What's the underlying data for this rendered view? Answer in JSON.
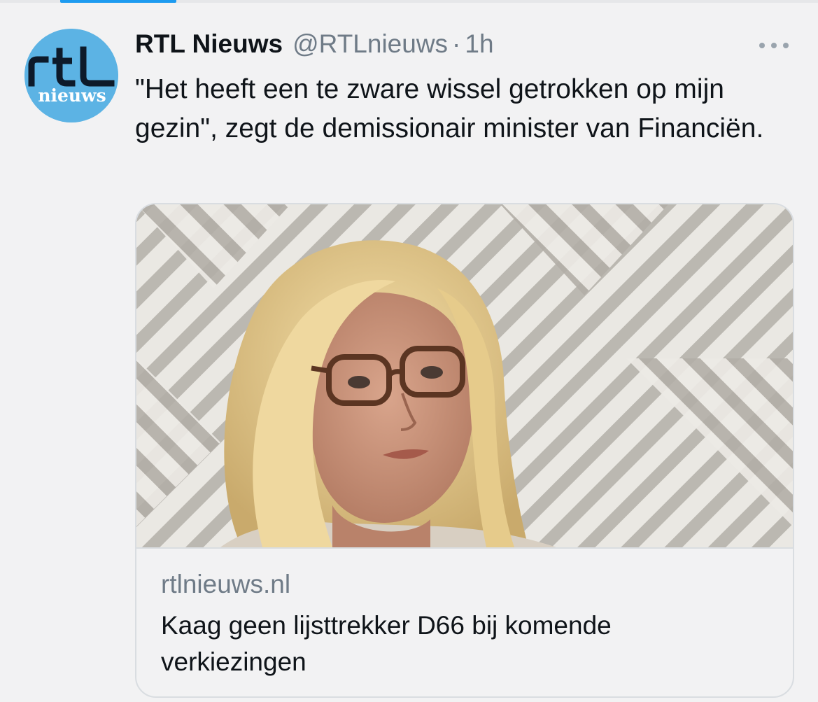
{
  "tweet": {
    "author": {
      "display_name": "RTL Nieuws",
      "handle": "@RTLnieuws",
      "avatar_logo_text": "rtl",
      "avatar_logo_subtext": "nieuws"
    },
    "separator": "·",
    "time": "1h",
    "more_icon": "more-horizontal-icon",
    "text": "\"Het heeft een te zware wissel getrokken op mijn gezin\", zegt de demissionair minister van Financiën.",
    "card": {
      "image": "photo-woman-glasses",
      "domain": "rtlnieuws.nl",
      "title": "Kaag geen lijsttrekker D66 bij komende verkiezingen"
    }
  },
  "colors": {
    "background": "#f2f2f3",
    "accent": "#1d9bf0",
    "avatar_bg": "#5cb3e4",
    "muted_text": "#6f7b87",
    "text": "#0f1419",
    "border": "#d9dde1"
  }
}
